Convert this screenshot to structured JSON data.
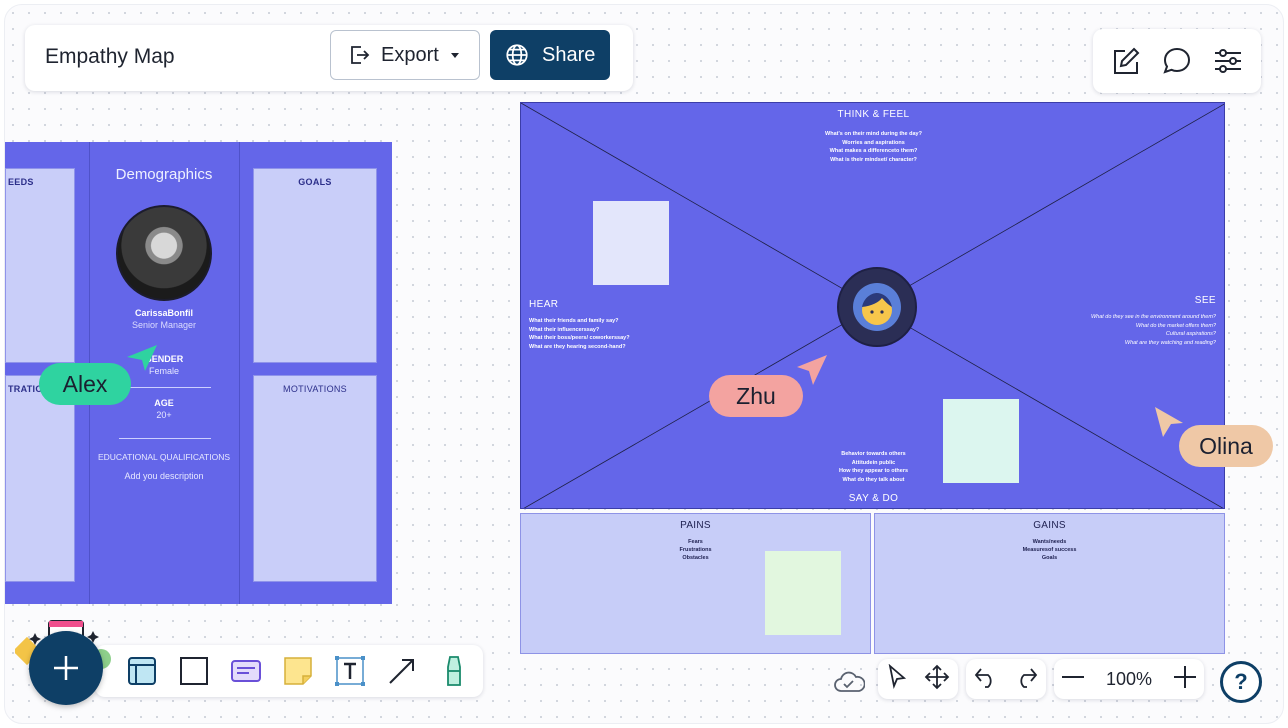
{
  "app": {
    "document_title": "Empathy Map",
    "export_label": "Export",
    "share_label": "Share"
  },
  "top_tools": [
    "edit-icon",
    "comment-icon",
    "settings-sliders-icon"
  ],
  "persona_board": {
    "needs_label": "EEDS",
    "frustrations_label": "TRATIO",
    "goals_label": "GOALS",
    "motivations_label": "MOTIVATIONS",
    "demographics_title": "Demographics",
    "name": "CarissaBonfil",
    "role": "Senior Manager",
    "gender_label": "GENDER",
    "gender_value": "Female",
    "age_label": "AGE",
    "age_value": "20+",
    "education_label": "EDUCATIONAL QUALIFICATIONS",
    "education_value": "Add you description"
  },
  "empathy_map": {
    "think_feel": {
      "title": "THINK & FEEL",
      "lines": [
        "What's on their mind during the day?",
        "Worries and aspirations",
        "What makes a differenceto them?",
        "What is their mindset/ character?"
      ]
    },
    "hear": {
      "title": "HEAR",
      "lines": [
        "What their friends and family say?",
        "What their influencerssay?",
        "What their boss/peers/ coworkerssay?",
        "What are they hearing second-hand?"
      ]
    },
    "see": {
      "title": "SEE",
      "lines": [
        "What do they see in the environment around them?",
        "What do the market offers them?",
        "Cultural aspirations?",
        "What are they watching and reading?"
      ]
    },
    "say_do": {
      "title": "SAY & DO",
      "lines": [
        "Behavior towards others",
        "Attitudein public",
        "How they appear to others",
        "What do they talk about"
      ]
    },
    "pains": {
      "title": "PAINS",
      "lines": [
        "Fears",
        "Frustrations",
        "Obstacles"
      ]
    },
    "gains": {
      "title": "GAINS",
      "lines": [
        "Wants/needs",
        "Measuresof success",
        "Goals"
      ]
    }
  },
  "collaborators": [
    {
      "name": "Alex",
      "color": "#2fd3a0"
    },
    {
      "name": "Zhu",
      "color": "#f3a3a0"
    },
    {
      "name": "Olina",
      "color": "#efc8a6"
    }
  ],
  "bottom_tools": [
    "frame-icon",
    "rectangle-icon",
    "card-icon",
    "sticky-note-icon",
    "text-icon",
    "arrow-icon",
    "marker-icon"
  ],
  "view": {
    "zoom": "100%"
  },
  "colors": {
    "brand_dark": "#0e3f66",
    "board_purple": "#6466e9",
    "card_lavender": "#c9cef9"
  }
}
